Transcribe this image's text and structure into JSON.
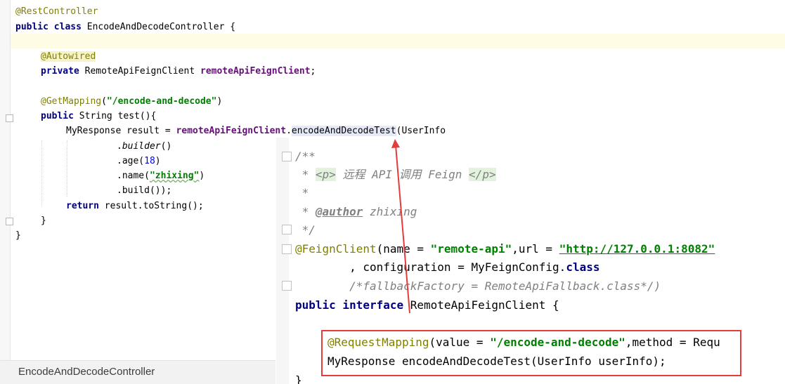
{
  "left_editor": {
    "line_rest": "@RestController",
    "class_kw": "public class ",
    "class_name": "EncodeAndDecodeController {",
    "autowired": "@Autowired",
    "private_kw": "private ",
    "field_type": "RemoteApiFeignClient ",
    "field_name": "remoteApiFeignClient",
    "semi": ";",
    "getmapping": "@GetMapping",
    "gm_open": "(",
    "gm_path": "\"/encode-and-decode\"",
    "gm_close": ")",
    "public_kw": "public ",
    "method_sig": "String test(){",
    "resp_decl": "MyResponse result = ",
    "client_ref": "remoteApiFeignClient",
    "dot": ".",
    "method_call": "encodeAndDecodeTest",
    "call_arg": "(UserInfo",
    "builder": "builder",
    "builder_parens": "()",
    "age_prefix": ".age(",
    "age_value": "18",
    "age_suffix": ")",
    "name_prefix": ".name(",
    "name_value": "\"zhixing\"",
    "name_suffix": ")",
    "build_line": ".build());",
    "return_kw": "return ",
    "return_expr": "result.toString();",
    "close_method": "}",
    "close_class": "}"
  },
  "tab": {
    "label": "EncodeAndDecodeController"
  },
  "right_editor": {
    "doc_open": "/**",
    "doc_star": " * ",
    "doc_p_open": "<p>",
    "doc_text": " 远程 API 调用 Feign ",
    "doc_p_close": "</p>",
    "doc_empty": " *",
    "doc_author_tag": "@author",
    "doc_author_name": " zhixing",
    "doc_close": " */",
    "feign_ann": "@FeignClient",
    "feign_args1": "(name = ",
    "feign_name": "\"remote-api\"",
    "feign_args2": ",url = ",
    "feign_url": "\"http://127.0.0.1:8082\"",
    "config_prefix": "        , configuration = MyFeignConfig.",
    "config_class_kw": "class",
    "fallback_comment": "        /*fallbackFactory = RemoteApiFallback.class*/)",
    "iface_kw": "public interface ",
    "iface_name": "RemoteApiFeignClient {",
    "rm_ann": "@RequestMapping",
    "rm_args1": "(value = ",
    "rm_path": "\"/encode-and-decode\"",
    "rm_args2": ",method = Requ",
    "rm_method": "MyResponse encodeAndDecodeTest(UserInfo userInfo);",
    "close_brace": "}"
  },
  "colors": {
    "annotation": "#808000",
    "keyword": "#000080",
    "string": "#008000",
    "field": "#660e7a",
    "highlight_box": "#e53b3b"
  }
}
